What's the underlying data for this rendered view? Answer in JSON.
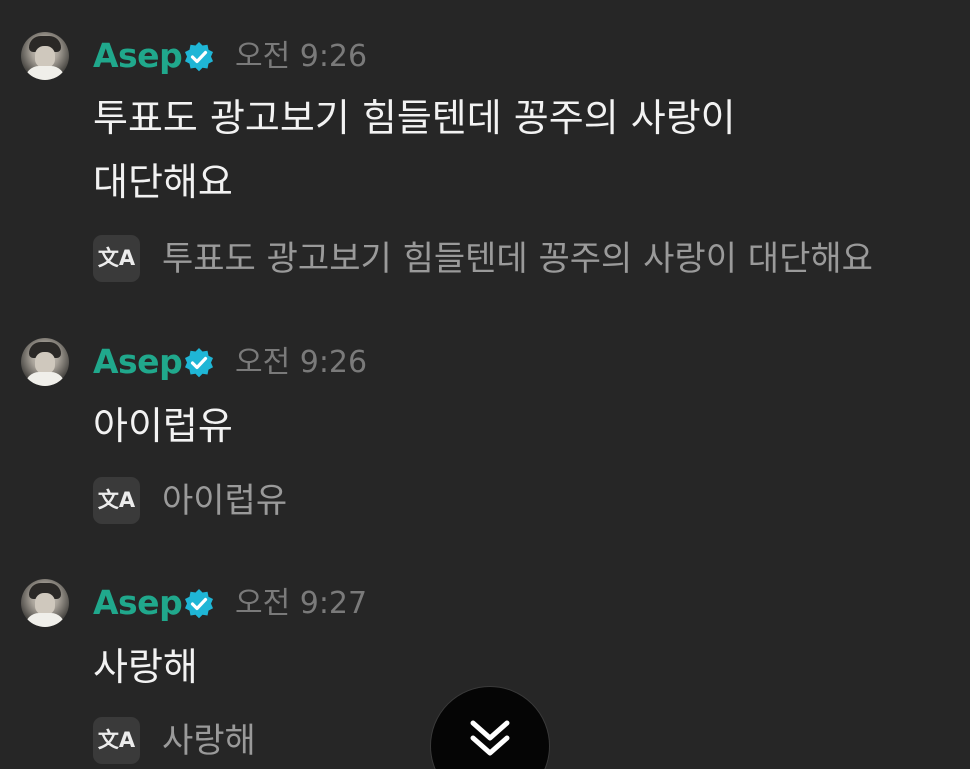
{
  "messages": [
    {
      "username": "Asep",
      "time": "오전 9:26",
      "text": "투표도 광고보기 힘들텐데 꽁주의 사랑이 대단해요",
      "text_lines": [
        "투표도 광고보기 힘들텐데 꽁주의 사랑이",
        "대단해요"
      ],
      "translation": "투표도 광고보기 힘들텐데 꽁주의 사랑이 대단해요"
    },
    {
      "username": "Asep",
      "time": "오전 9:26",
      "text": "아이럽유",
      "translation": "아이럽유"
    },
    {
      "username": "Asep",
      "time": "오전 9:27",
      "text": "사랑해",
      "translation": "사랑해"
    }
  ],
  "icons": {
    "verified": "verified-badge-icon",
    "translate": "translate-icon",
    "scroll_down": "double-chevron-down-icon"
  },
  "translate_icon_glyph": "文A",
  "colors": {
    "background": "#262626",
    "username": "#20a88c",
    "verified_badge": "#1fb6d6",
    "message_text": "#f2f2f2",
    "timestamp": "#7a7a7a",
    "translation_text": "#9a9a9a"
  }
}
